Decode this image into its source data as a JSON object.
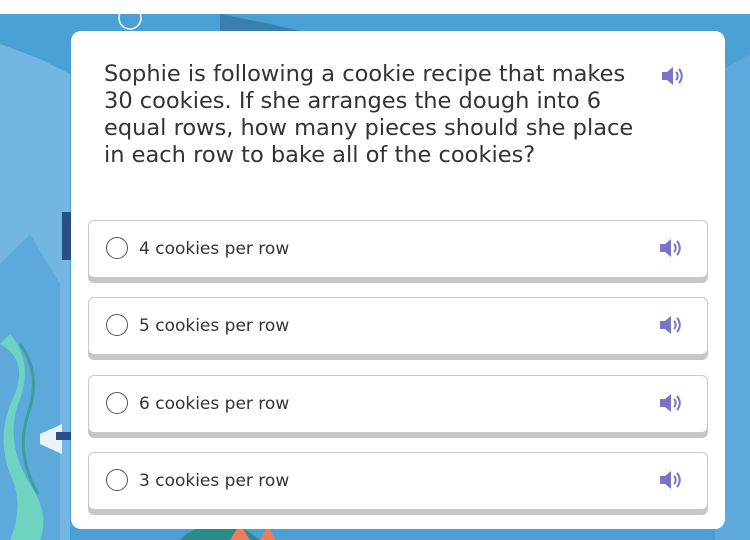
{
  "question": {
    "text": "Sophie is following a cookie recipe that makes 30 cookies. If she arranges the dough into 6 equal rows, how many pieces should she place in each row to bake all of the cookies?",
    "audio_icon": "speaker-icon"
  },
  "options": [
    {
      "label": "4 cookies per row",
      "selected": false
    },
    {
      "label": "5 cookies per row",
      "selected": false
    },
    {
      "label": "6 cookies per row",
      "selected": false
    },
    {
      "label": "3 cookies per row",
      "selected": false
    }
  ],
  "colors": {
    "background": "#4a9fd5",
    "card": "#ffffff",
    "speaker": "#7a73c8",
    "text": "#333333"
  }
}
